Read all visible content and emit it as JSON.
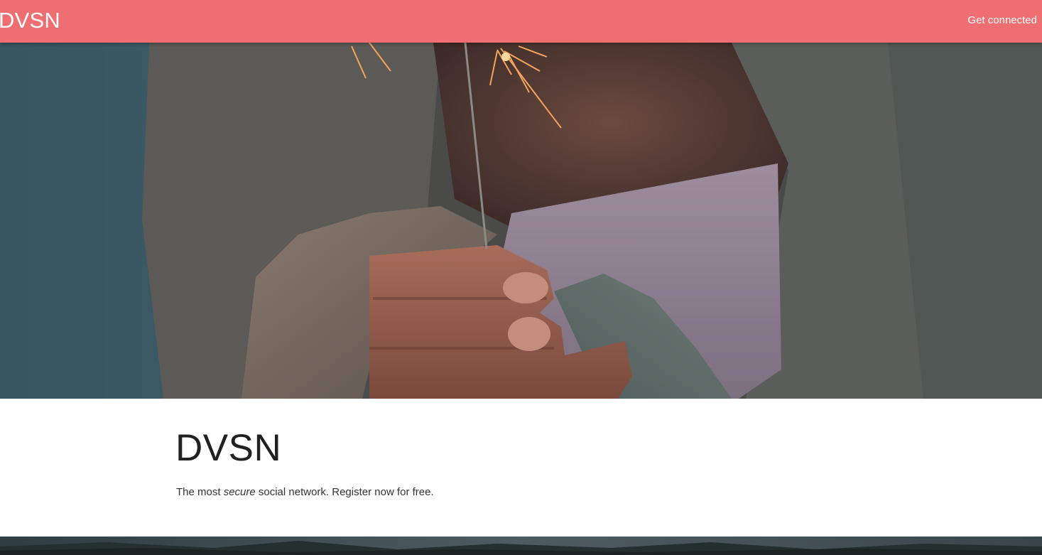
{
  "navbar": {
    "brand": "DVSN",
    "link_label": "Get connected",
    "background_color": "#ef6e72"
  },
  "hero": {
    "image_icon": "sparkler-photo"
  },
  "content": {
    "headline": "DVSN",
    "tagline_before": "The most ",
    "tagline_emphasis": "secure",
    "tagline_after": " social network. Register now for free."
  },
  "footer_strip": {
    "image_icon": "forest-landscape-photo"
  }
}
